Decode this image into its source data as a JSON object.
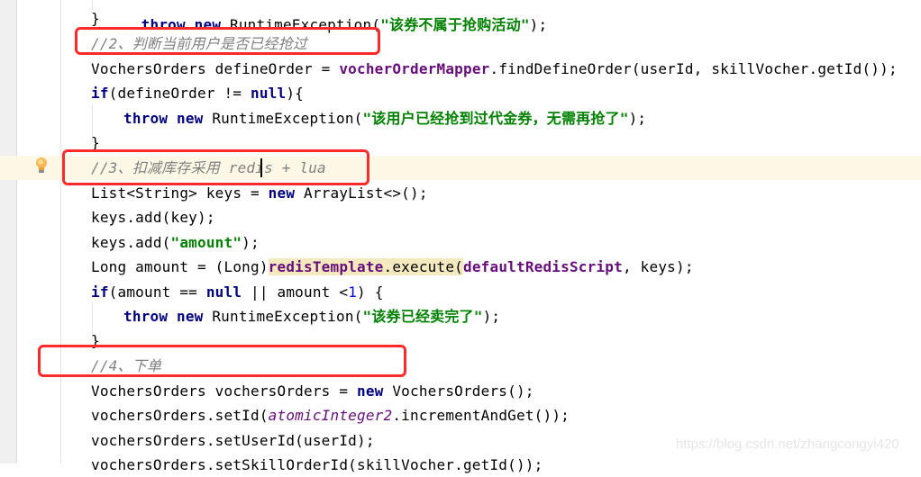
{
  "editor": {
    "lines": [
      {
        "id": "l0",
        "parts": [
          [
            "kw",
            "throw "
          ],
          [
            "kw",
            "new "
          ],
          [
            "plain",
            "RuntimeException("
          ],
          [
            "str",
            "\"该券不属于抢购活动\""
          ],
          [
            "plain",
            ");"
          ]
        ]
      },
      {
        "id": "l1",
        "text": "}"
      },
      {
        "id": "l2",
        "comment": "//2、判断当前用户是否已经抢过"
      },
      {
        "id": "l3",
        "p1": "VochersOrders defineOrder = ",
        "field": "vocherOrderMapper",
        "p2": ".findDefineOrder(userId, skillVocher.getId());"
      },
      {
        "id": "l4",
        "kw": "if",
        "p1": "(defineOrder != ",
        "kw2": "null",
        "p2": "){"
      },
      {
        "id": "l5",
        "kw": "throw",
        "kw2": "new",
        "p1": " RuntimeException(",
        "str": "\"该用户已经抢到过代金券，无需再抢了\"",
        "p2": ");"
      },
      {
        "id": "l6",
        "text": "}"
      },
      {
        "id": "l7",
        "comment": "//3、扣减库存采用 redis + lua"
      },
      {
        "id": "l8",
        "p1": "List<String> keys = ",
        "kw": "new",
        "p2": " ArrayList<>();"
      },
      {
        "id": "l9",
        "text": "keys.add(key);"
      },
      {
        "id": "l10",
        "p1": "keys.add(",
        "str": "\"amount\"",
        "p2": ");"
      },
      {
        "id": "l11",
        "p1": "Long amount = (Long)",
        "field": "redisTemplate",
        "p2": ".execute(",
        "field2": "defaultRedisScript",
        "p3": ", keys);"
      },
      {
        "id": "l12",
        "kw": "if",
        "p1": "(amount == ",
        "kw2": "null",
        "p2": " || amount <",
        "num": "1",
        "p3": ") {"
      },
      {
        "id": "l13",
        "kw": "throw",
        "kw2": "new",
        "p1": " RuntimeException(",
        "str": "\"该券已经卖完了\"",
        "p2": ");"
      },
      {
        "id": "l14",
        "text": "}"
      },
      {
        "id": "l15",
        "comment": "//4、下单"
      },
      {
        "id": "l16",
        "p1": "VochersOrders vochersOrders = ",
        "kw": "new",
        "p2": " VochersOrders();"
      },
      {
        "id": "l17",
        "p1": "vochersOrders.setId(",
        "sfield": "atomicInteger2",
        "p2": ".incrementAndGet());"
      },
      {
        "id": "l18",
        "text": "vochersOrders.setUserId(userId);"
      },
      {
        "id": "l19",
        "text": "vochersOrders.setSkillOrderId(skillVocher.getId());"
      }
    ]
  },
  "gutter": {
    "intention_icon": "lightbulb-icon"
  },
  "annotations": {
    "color": "#ff2a2a",
    "boxes": [
      "comment-2",
      "comment-3",
      "comment-4"
    ]
  },
  "watermark": "https://blog.csdn.net/zhangcongyi420",
  "colors": {
    "keyword": "#000080",
    "string": "#008000",
    "comment": "#808080",
    "field": "#660e7a",
    "number": "#0000ff",
    "caret_line": "#fdf8e6",
    "usage_highlight": "#f5eabf"
  }
}
